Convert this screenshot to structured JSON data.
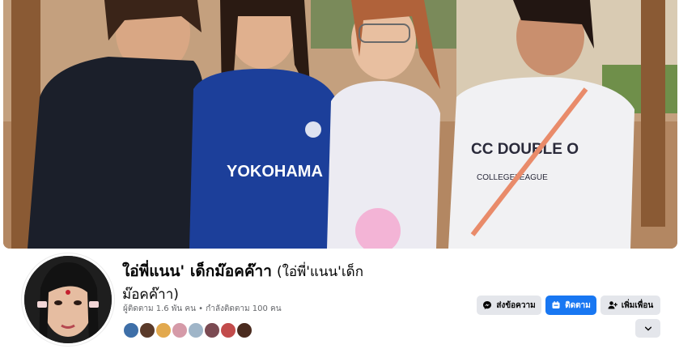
{
  "profile": {
    "name": "ใอ่พี่แนน' เด็กม๊อคค๊าา",
    "alternate_name_part1": "(ใอ่พี่'แนน'เด็ก",
    "alternate_name_part2": "ม๊อคค๊าา)",
    "follow_stats": "ผู้ติดตาม 1.6 พัน คน • กำลังติดตาม 100 คน"
  },
  "actions": {
    "message_label": "ส่งข้อความ",
    "follow_label": "ติดตาม",
    "add_friend_label": "เพิ่มเพื่อน"
  },
  "colors": {
    "accent": "#1877f2",
    "button_gray": "#e4e6eb",
    "secondary_text": "#65676b"
  },
  "icons": {
    "message": "messenger-icon",
    "follow": "follow-icon",
    "add_friend": "add-friend-icon",
    "more": "chevron-down-icon"
  }
}
